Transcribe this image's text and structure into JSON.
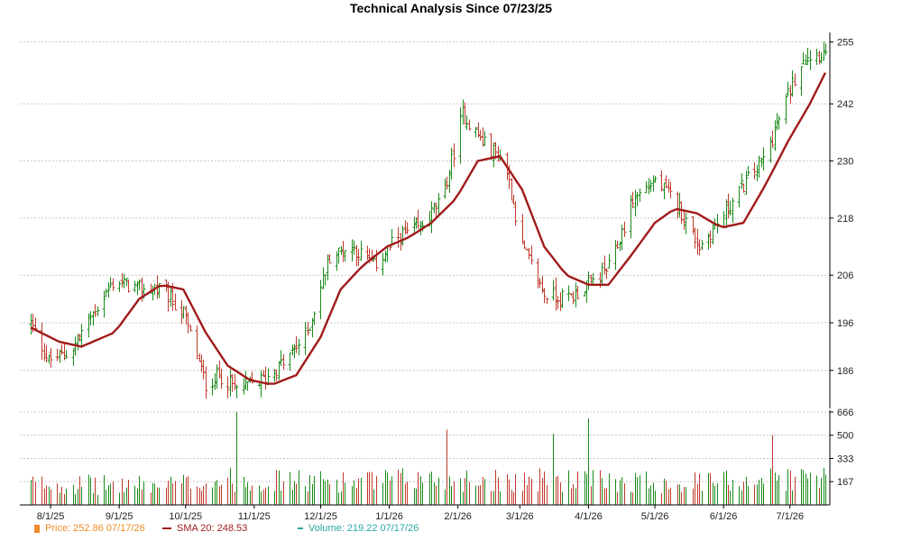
{
  "chart_data": {
    "type": "line",
    "title": "Technical Analysis Since 07/23/25",
    "price_axis": {
      "ticks": [
        186,
        196,
        206,
        218,
        230,
        242,
        255
      ],
      "ylim": [
        178,
        257
      ]
    },
    "volume_axis": {
      "ticks": [
        167,
        333,
        500,
        666
      ],
      "ylim": [
        0,
        666
      ]
    },
    "x_ticks": [
      "8/1/25",
      "9/1/25",
      "10/1/25",
      "11/1/25",
      "12/1/25",
      "1/1/26",
      "2/1/26",
      "3/1/26",
      "4/1/26",
      "5/1/26",
      "6/1/26",
      "7/1/26"
    ],
    "grid": true,
    "series": [
      {
        "name": "Price",
        "kind": "ohlc",
        "anchors": {
          "dates": [
            "7/23/25",
            "7/31/25",
            "8/10/25",
            "8/20/25",
            "8/30/25",
            "9/10/25",
            "9/20/25",
            "9/30/25",
            "10/10/25",
            "10/16/25",
            "10/24/25",
            "11/5/25",
            "11/15/25",
            "11/25/25",
            "12/5/25",
            "12/15/25",
            "12/25/25",
            "1/5/26",
            "1/15/26",
            "1/25/26",
            "2/3/26",
            "2/12/26",
            "2/22/26",
            "3/2/26",
            "3/12/26",
            "3/22/26",
            "4/1/26",
            "4/11/26",
            "4/21/26",
            "5/1/26",
            "5/11/26",
            "5/21/26",
            "5/31/26",
            "6/10/26",
            "6/20/26",
            "6/30/26",
            "7/7/26",
            "7/17/26"
          ],
          "values": [
            196,
            188,
            190,
            198,
            205,
            203,
            203,
            198,
            183,
            185,
            182,
            184,
            188,
            194,
            210,
            212,
            208,
            214,
            216,
            222,
            240,
            234,
            230,
            212,
            202,
            201,
            204,
            208,
            222,
            226,
            221,
            212,
            218,
            225,
            231,
            244,
            252,
            252.86
          ]
        }
      },
      {
        "name": "SMA 20",
        "kind": "line",
        "anchors": {
          "dates": [
            "7/23/25",
            "8/5/25",
            "8/15/25",
            "8/30/25",
            "9/10/25",
            "9/20/25",
            "9/30/25",
            "10/10/25",
            "10/20/25",
            "10/30/25",
            "11/9/25",
            "11/20/25",
            "12/1/25",
            "12/10/25",
            "12/20/25",
            "12/31/25",
            "1/10/26",
            "1/20/26",
            "1/31/26",
            "2/10/26",
            "2/20/26",
            "3/2/26",
            "3/12/26",
            "3/22/26",
            "4/1/26",
            "4/10/26",
            "4/20/26",
            "5/1/26",
            "5/10/26",
            "5/20/26",
            "5/31/26",
            "6/10/26",
            "6/20/26",
            "6/30/26",
            "7/10/26",
            "7/17/26"
          ],
          "values": [
            195,
            192,
            191,
            194,
            201,
            204,
            203,
            194,
            187,
            184,
            183,
            185,
            193,
            203,
            208,
            212,
            214,
            217,
            222,
            230,
            231,
            224,
            212,
            206,
            204,
            204,
            210,
            217,
            220,
            219,
            216,
            217,
            225,
            234,
            242,
            248.53
          ]
        }
      },
      {
        "name": "Volume",
        "kind": "bar",
        "anchors": {
          "dates": [
            "7/23/25",
            "8/20/25",
            "9/20/25",
            "10/20/25",
            "11/20/25",
            "12/20/25",
            "1/20/26",
            "2/20/26",
            "3/20/26",
            "4/20/26",
            "5/20/26",
            "6/20/26",
            "7/17/26"
          ],
          "values": [
            170,
            160,
            155,
            200,
            190,
            185,
            210,
            200,
            195,
            190,
            180,
            210,
            219.22
          ]
        }
      }
    ],
    "highlight_volume_bars": [
      {
        "date": "10/24/25",
        "value": 666
      },
      {
        "date": "1/27/26",
        "value": 540
      },
      {
        "date": "1/31/26",
        "value": 560
      },
      {
        "date": "3/16/26",
        "value": 510
      },
      {
        "date": "4/1/26",
        "value": 620
      },
      {
        "date": "6/23/26",
        "value": 500
      }
    ],
    "legend": [
      {
        "label": "Price: 252.86  07/17/26",
        "color": "#f08c2a"
      },
      {
        "label": "SMA 20: 248.53",
        "color": "#9e1a1a"
      },
      {
        "label": "Volume: 219.22  07/17/26",
        "color": "#2aa7a3"
      }
    ],
    "colors": {
      "up": "#1a8a1a",
      "down": "#c0392b",
      "sma": "#a01a1a",
      "grid": "#c8c8c8",
      "axis": "#000000"
    }
  }
}
